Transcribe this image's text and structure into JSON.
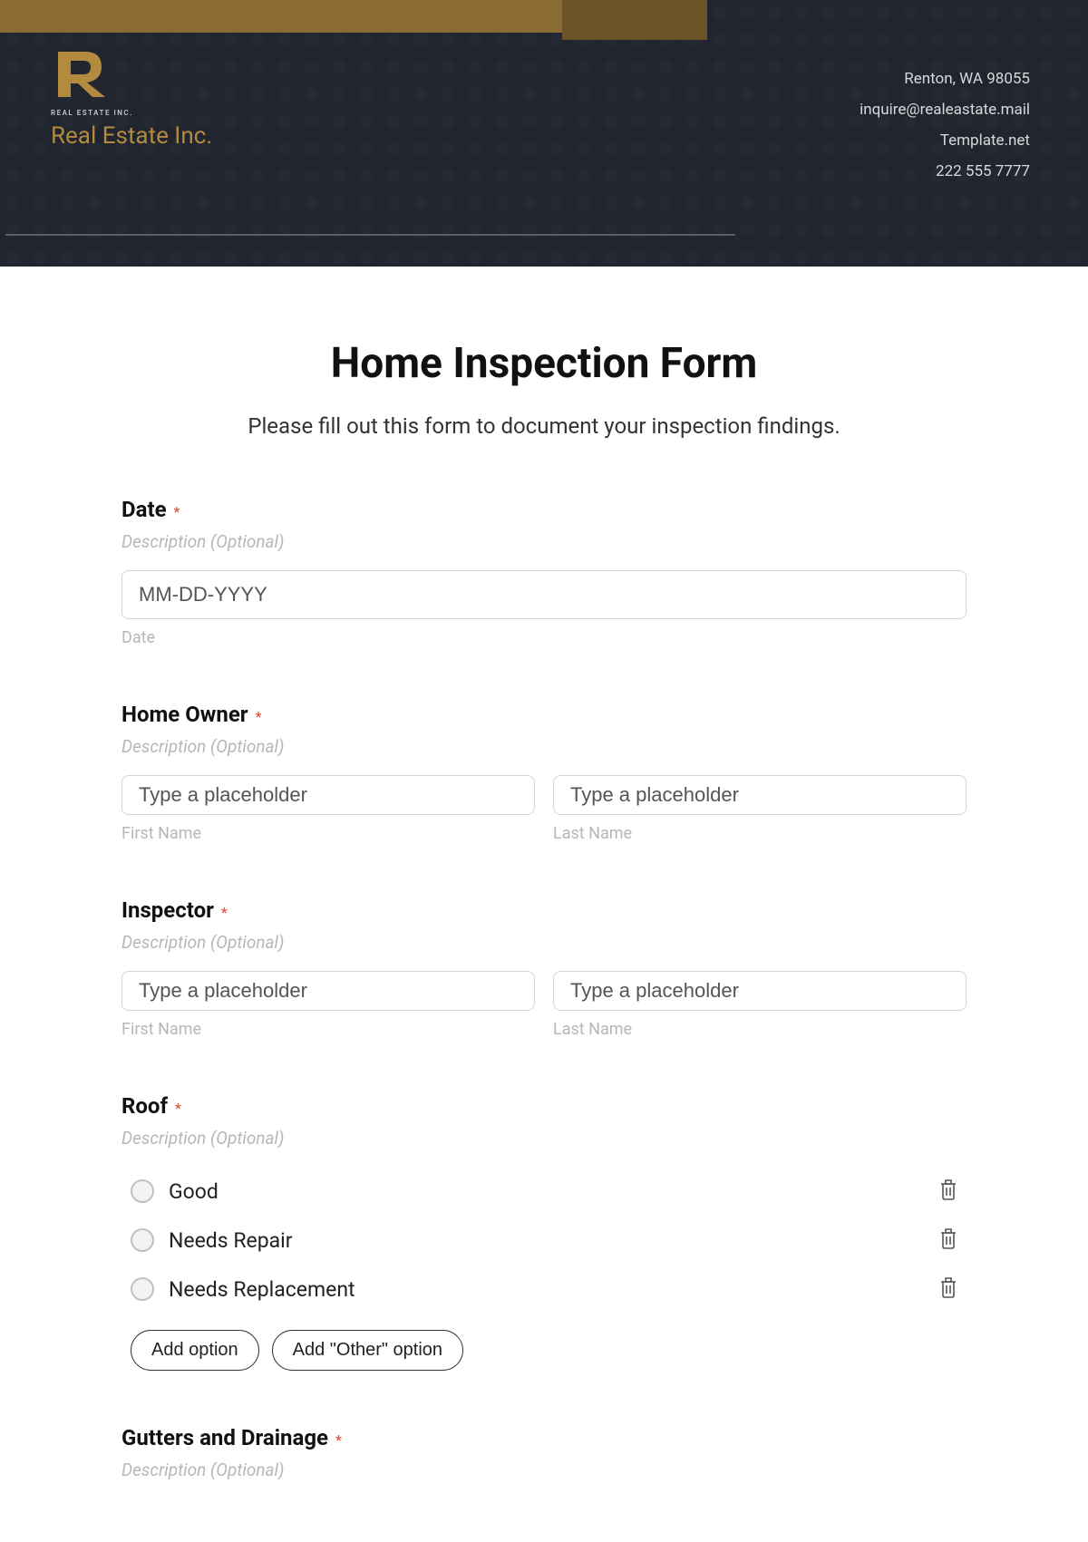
{
  "header": {
    "logo_sub": "REAL ESTATE INC.",
    "company_name": "Real Estate Inc.",
    "contact": {
      "address": "Renton, WA 98055",
      "email": "inquire@realeastate.mail",
      "site": "Template.net",
      "phone": "222 555 7777"
    }
  },
  "form": {
    "title": "Home Inspection Form",
    "subtitle": "Please fill out this form to document your inspection findings.",
    "required_mark": "*",
    "description_placeholder": "Description (Optional)",
    "add_option_label": "Add option",
    "add_other_label": "Add \"Other\" option",
    "fields": {
      "date": {
        "label": "Date",
        "placeholder": "MM-DD-YYYY",
        "sublabel": "Date"
      },
      "homeowner": {
        "label": "Home Owner",
        "first_placeholder": "Type a placeholder",
        "last_placeholder": "Type a placeholder",
        "first_sublabel": "First Name",
        "last_sublabel": "Last Name"
      },
      "inspector": {
        "label": "Inspector",
        "first_placeholder": "Type a placeholder",
        "last_placeholder": "Type a placeholder",
        "first_sublabel": "First Name",
        "last_sublabel": "Last Name"
      },
      "roof": {
        "label": "Roof",
        "options": [
          "Good",
          "Needs Repair",
          "Needs Replacement"
        ]
      },
      "gutters": {
        "label": "Gutters and Drainage"
      }
    }
  }
}
